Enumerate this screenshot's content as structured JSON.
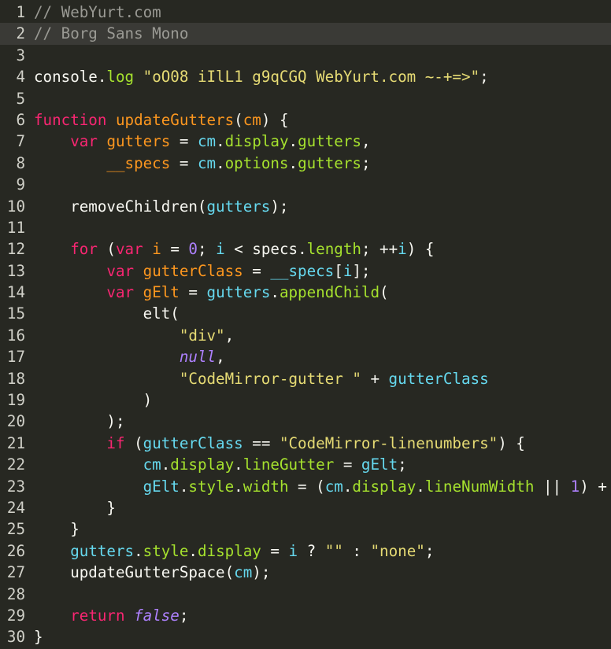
{
  "editor": {
    "active_line": 2,
    "lines": [
      {
        "n": "1",
        "tokens": [
          {
            "c": "comment",
            "t": "// WebYurt.com"
          }
        ]
      },
      {
        "n": "2",
        "tokens": [
          {
            "c": "comment",
            "t": "// Borg Sans Mono"
          }
        ]
      },
      {
        "n": "3",
        "tokens": []
      },
      {
        "n": "4",
        "tokens": [
          {
            "c": "plain",
            "t": "console."
          },
          {
            "c": "property",
            "t": "log"
          },
          {
            "c": "plain",
            "t": " "
          },
          {
            "c": "string",
            "t": "\"oO08 iIlL1 g9qCGQ WebYurt.com ~-+=>\""
          },
          {
            "c": "plain",
            "t": ";"
          }
        ]
      },
      {
        "n": "5",
        "tokens": []
      },
      {
        "n": "6",
        "tokens": [
          {
            "c": "keyword",
            "t": "function"
          },
          {
            "c": "plain",
            "t": " "
          },
          {
            "c": "def",
            "t": "updateGutters"
          },
          {
            "c": "plain",
            "t": "("
          },
          {
            "c": "def",
            "t": "cm"
          },
          {
            "c": "plain",
            "t": ") {"
          }
        ]
      },
      {
        "n": "7",
        "tokens": [
          {
            "c": "plain",
            "t": "    "
          },
          {
            "c": "keyword",
            "t": "var"
          },
          {
            "c": "plain",
            "t": " "
          },
          {
            "c": "def",
            "t": "gutters"
          },
          {
            "c": "plain",
            "t": " = "
          },
          {
            "c": "var2",
            "t": "cm"
          },
          {
            "c": "plain",
            "t": "."
          },
          {
            "c": "property",
            "t": "display"
          },
          {
            "c": "plain",
            "t": "."
          },
          {
            "c": "property",
            "t": "gutters"
          },
          {
            "c": "plain",
            "t": ","
          }
        ]
      },
      {
        "n": "8",
        "tokens": [
          {
            "c": "plain",
            "t": "        "
          },
          {
            "c": "def",
            "t": "__specs"
          },
          {
            "c": "plain",
            "t": " = "
          },
          {
            "c": "var2",
            "t": "cm"
          },
          {
            "c": "plain",
            "t": "."
          },
          {
            "c": "property",
            "t": "options"
          },
          {
            "c": "plain",
            "t": "."
          },
          {
            "c": "property",
            "t": "gutters"
          },
          {
            "c": "plain",
            "t": ";"
          }
        ]
      },
      {
        "n": "9",
        "tokens": []
      },
      {
        "n": "10",
        "tokens": [
          {
            "c": "plain",
            "t": "    removeChildren("
          },
          {
            "c": "var2",
            "t": "gutters"
          },
          {
            "c": "plain",
            "t": ");"
          }
        ]
      },
      {
        "n": "11",
        "tokens": []
      },
      {
        "n": "12",
        "tokens": [
          {
            "c": "plain",
            "t": "    "
          },
          {
            "c": "keyword",
            "t": "for"
          },
          {
            "c": "plain",
            "t": " ("
          },
          {
            "c": "keyword",
            "t": "var"
          },
          {
            "c": "plain",
            "t": " "
          },
          {
            "c": "def",
            "t": "i"
          },
          {
            "c": "plain",
            "t": " = "
          },
          {
            "c": "number",
            "t": "0"
          },
          {
            "c": "plain",
            "t": "; "
          },
          {
            "c": "var2",
            "t": "i"
          },
          {
            "c": "plain",
            "t": " < specs."
          },
          {
            "c": "property",
            "t": "length"
          },
          {
            "c": "plain",
            "t": "; ++"
          },
          {
            "c": "var2",
            "t": "i"
          },
          {
            "c": "plain",
            "t": ") {"
          }
        ]
      },
      {
        "n": "13",
        "tokens": [
          {
            "c": "plain",
            "t": "        "
          },
          {
            "c": "keyword",
            "t": "var"
          },
          {
            "c": "plain",
            "t": " "
          },
          {
            "c": "def",
            "t": "gutterClass"
          },
          {
            "c": "plain",
            "t": " = "
          },
          {
            "c": "var2",
            "t": "__specs"
          },
          {
            "c": "plain",
            "t": "["
          },
          {
            "c": "var2",
            "t": "i"
          },
          {
            "c": "plain",
            "t": "];"
          }
        ]
      },
      {
        "n": "14",
        "tokens": [
          {
            "c": "plain",
            "t": "        "
          },
          {
            "c": "keyword",
            "t": "var"
          },
          {
            "c": "plain",
            "t": " "
          },
          {
            "c": "def",
            "t": "gElt"
          },
          {
            "c": "plain",
            "t": " = "
          },
          {
            "c": "var2",
            "t": "gutters"
          },
          {
            "c": "plain",
            "t": "."
          },
          {
            "c": "property",
            "t": "appendChild"
          },
          {
            "c": "plain",
            "t": "("
          }
        ]
      },
      {
        "n": "15",
        "tokens": [
          {
            "c": "plain",
            "t": "            elt("
          }
        ]
      },
      {
        "n": "16",
        "tokens": [
          {
            "c": "plain",
            "t": "                "
          },
          {
            "c": "string",
            "t": "\"div\""
          },
          {
            "c": "plain",
            "t": ","
          }
        ]
      },
      {
        "n": "17",
        "tokens": [
          {
            "c": "plain",
            "t": "                "
          },
          {
            "c": "atom",
            "t": "null"
          },
          {
            "c": "plain",
            "t": ","
          }
        ]
      },
      {
        "n": "18",
        "tokens": [
          {
            "c": "plain",
            "t": "                "
          },
          {
            "c": "string",
            "t": "\"CodeMirror-gutter \""
          },
          {
            "c": "plain",
            "t": " + "
          },
          {
            "c": "var2",
            "t": "gutterClass"
          }
        ]
      },
      {
        "n": "19",
        "tokens": [
          {
            "c": "plain",
            "t": "            )"
          }
        ]
      },
      {
        "n": "20",
        "tokens": [
          {
            "c": "plain",
            "t": "        );"
          }
        ]
      },
      {
        "n": "21",
        "tokens": [
          {
            "c": "plain",
            "t": "        "
          },
          {
            "c": "keyword",
            "t": "if"
          },
          {
            "c": "plain",
            "t": " ("
          },
          {
            "c": "var2",
            "t": "gutterClass"
          },
          {
            "c": "plain",
            "t": " == "
          },
          {
            "c": "string",
            "t": "\"CodeMirror-linenumbers\""
          },
          {
            "c": "plain",
            "t": ") {"
          }
        ]
      },
      {
        "n": "22",
        "tokens": [
          {
            "c": "plain",
            "t": "            "
          },
          {
            "c": "var2",
            "t": "cm"
          },
          {
            "c": "plain",
            "t": "."
          },
          {
            "c": "property",
            "t": "display"
          },
          {
            "c": "plain",
            "t": "."
          },
          {
            "c": "property",
            "t": "lineGutter"
          },
          {
            "c": "plain",
            "t": " = "
          },
          {
            "c": "var2",
            "t": "gElt"
          },
          {
            "c": "plain",
            "t": ";"
          }
        ]
      },
      {
        "n": "23",
        "tokens": [
          {
            "c": "plain",
            "t": "            "
          },
          {
            "c": "var2",
            "t": "gElt"
          },
          {
            "c": "plain",
            "t": "."
          },
          {
            "c": "property",
            "t": "style"
          },
          {
            "c": "plain",
            "t": "."
          },
          {
            "c": "property",
            "t": "width"
          },
          {
            "c": "plain",
            "t": " = ("
          },
          {
            "c": "var2",
            "t": "cm"
          },
          {
            "c": "plain",
            "t": "."
          },
          {
            "c": "property",
            "t": "display"
          },
          {
            "c": "plain",
            "t": "."
          },
          {
            "c": "property",
            "t": "lineNumWidth"
          },
          {
            "c": "plain",
            "t": " || "
          },
          {
            "c": "number",
            "t": "1"
          },
          {
            "c": "plain",
            "t": ") +"
          }
        ]
      },
      {
        "n": "24",
        "tokens": [
          {
            "c": "plain",
            "t": "        }"
          }
        ]
      },
      {
        "n": "25",
        "tokens": [
          {
            "c": "plain",
            "t": "    }"
          }
        ]
      },
      {
        "n": "26",
        "tokens": [
          {
            "c": "plain",
            "t": "    "
          },
          {
            "c": "var2",
            "t": "gutters"
          },
          {
            "c": "plain",
            "t": "."
          },
          {
            "c": "property",
            "t": "style"
          },
          {
            "c": "plain",
            "t": "."
          },
          {
            "c": "property",
            "t": "display"
          },
          {
            "c": "plain",
            "t": " = "
          },
          {
            "c": "var2",
            "t": "i"
          },
          {
            "c": "plain",
            "t": " ? "
          },
          {
            "c": "string",
            "t": "\"\""
          },
          {
            "c": "plain",
            "t": " : "
          },
          {
            "c": "string",
            "t": "\"none\""
          },
          {
            "c": "plain",
            "t": ";"
          }
        ]
      },
      {
        "n": "27",
        "tokens": [
          {
            "c": "plain",
            "t": "    updateGutterSpace("
          },
          {
            "c": "var2",
            "t": "cm"
          },
          {
            "c": "plain",
            "t": ");"
          }
        ]
      },
      {
        "n": "28",
        "tokens": []
      },
      {
        "n": "29",
        "tokens": [
          {
            "c": "plain",
            "t": "    "
          },
          {
            "c": "keyword",
            "t": "return"
          },
          {
            "c": "plain",
            "t": " "
          },
          {
            "c": "atom",
            "t": "false"
          },
          {
            "c": "plain",
            "t": ";"
          }
        ]
      },
      {
        "n": "30",
        "tokens": [
          {
            "c": "plain",
            "t": "}"
          }
        ]
      }
    ]
  }
}
